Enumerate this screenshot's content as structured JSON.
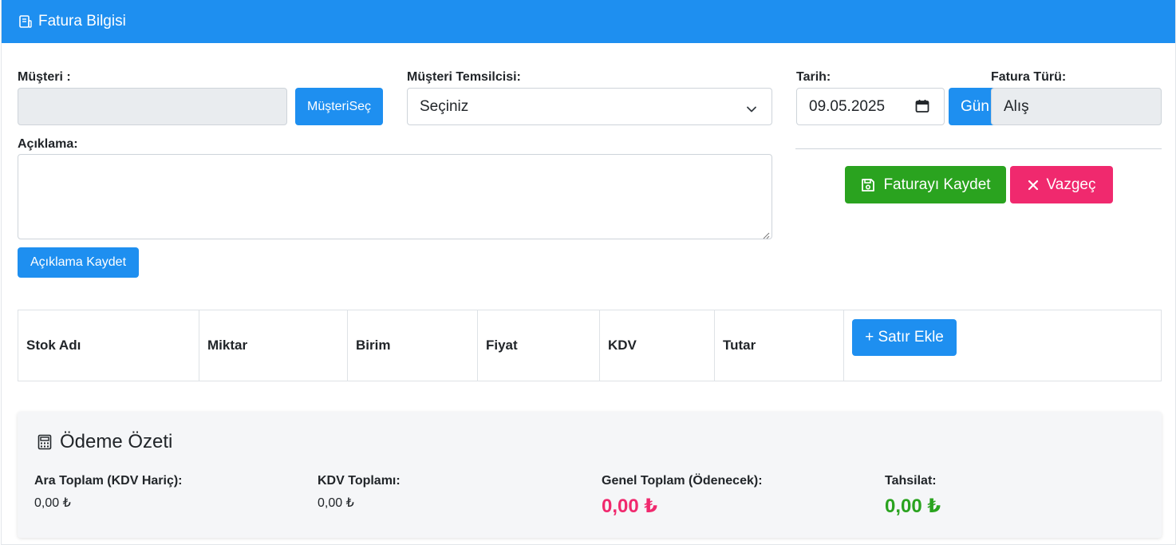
{
  "header": {
    "title": "Fatura Bilgisi",
    "icon": "invoice-icon"
  },
  "form": {
    "customer_label": "Müşteri :",
    "customer_value": "",
    "select_customer_button": "MüşteriSeç",
    "rep_label": "Müşteri Temsilcisi:",
    "rep_selected": "Seçiniz",
    "date_label": "Tarih:",
    "date_value": "09.05.2025",
    "today_button": "Gün",
    "invoice_type_label": "Fatura Türü:",
    "invoice_type_value": "Alış",
    "description_label": "Açıklama:",
    "description_value": "",
    "save_description_button": "Açıklama Kaydet"
  },
  "actions": {
    "save_invoice": "Faturayı Kaydet",
    "cancel": "Vazgeç"
  },
  "table": {
    "columns": [
      "Stok Adı",
      "Miktar",
      "Birim",
      "Fiyat",
      "KDV",
      "Tutar"
    ],
    "add_row_button": "+ Satır Ekle"
  },
  "summary": {
    "title": "Ödeme Özeti",
    "subtotal_label": "Ara Toplam (KDV Hariç):",
    "subtotal_value": "0,00 ₺",
    "vat_label": "KDV Toplamı:",
    "vat_value": "0,00 ₺",
    "grand_total_label": "Genel Toplam (Ödenecek):",
    "grand_total_value": "0,00 ₺",
    "collection_label": "Tahsilat:",
    "collection_value": "0,00 ₺"
  },
  "colors": {
    "primary": "#1e8ff0",
    "success": "#2aa31f",
    "danger": "#f0296e"
  }
}
